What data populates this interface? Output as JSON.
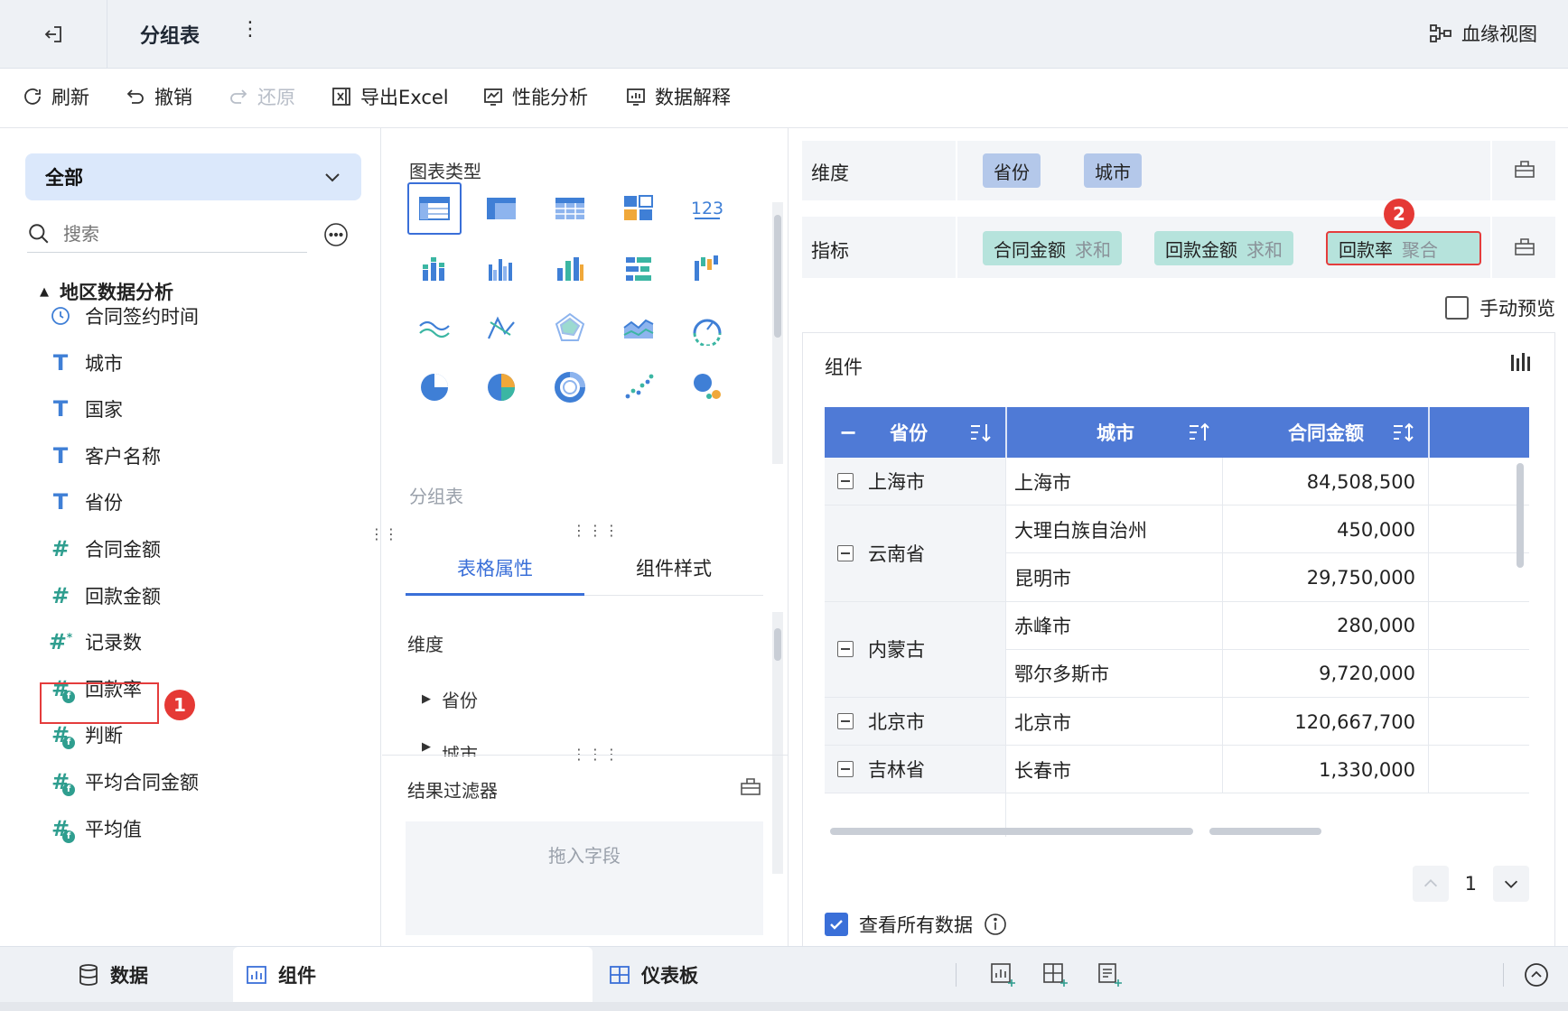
{
  "topbar": {
    "title": "分组表",
    "more": "⋮",
    "lineage_label": "血缘视图"
  },
  "toolbar": {
    "refresh": "刷新",
    "undo": "撤销",
    "redo": "还原",
    "export_excel": "导出Excel",
    "perf": "性能分析",
    "explain": "数据解释"
  },
  "left": {
    "scope": "全部",
    "search_placeholder": "搜索",
    "group": "地区数据分析",
    "fields": [
      {
        "label": "合同签约时间",
        "icon": "clock-icon"
      },
      {
        "label": "城市",
        "icon": "text-field-icon"
      },
      {
        "label": "国家",
        "icon": "text-field-icon"
      },
      {
        "label": "客户名称",
        "icon": "text-field-icon"
      },
      {
        "label": "省份",
        "icon": "text-field-icon"
      },
      {
        "label": "合同金额",
        "icon": "number-field-icon"
      },
      {
        "label": "回款金额",
        "icon": "number-field-icon"
      },
      {
        "label": "记录数",
        "icon": "count-field-icon"
      },
      {
        "label": "回款率",
        "icon": "calc-field-icon"
      },
      {
        "label": "判断",
        "icon": "calc-field-icon"
      },
      {
        "label": "平均合同金额",
        "icon": "calc-field-icon"
      },
      {
        "label": "平均值",
        "icon": "calc-field-icon"
      }
    ],
    "badge1": "1"
  },
  "middle": {
    "chart_type_label": "图表类型",
    "number_icon_text": "123",
    "selected_chart_name": "分组表",
    "tabs": [
      "表格属性",
      "组件样式"
    ],
    "dim_label": "维度",
    "dim_items": [
      "省份",
      "城市"
    ],
    "filter_label": "结果过滤器",
    "drop_hint": "拖入字段"
  },
  "right": {
    "dim_shelf": {
      "name": "维度",
      "pills": [
        "省份",
        "城市"
      ]
    },
    "met_shelf": {
      "name": "指标",
      "pills": [
        {
          "field": "合同金额",
          "agg": "求和"
        },
        {
          "field": "回款金额",
          "agg": "求和"
        },
        {
          "field": "回款率",
          "agg": "聚合"
        }
      ]
    },
    "badge2": "2",
    "manual_preview": "手动预览",
    "component_title": "组件",
    "table": {
      "headers": [
        "省份",
        "城市",
        "合同金额"
      ],
      "groups": [
        {
          "province": "上海市",
          "rows": [
            {
              "city": "上海市",
              "amount": "84,508,500"
            }
          ]
        },
        {
          "province": "云南省",
          "rows": [
            {
              "city": "大理白族自治州",
              "amount": "450,000"
            },
            {
              "city": "昆明市",
              "amount": "29,750,000"
            }
          ]
        },
        {
          "province": "内蒙古",
          "rows": [
            {
              "city": "赤峰市",
              "amount": "280,000"
            },
            {
              "city": "鄂尔多斯市",
              "amount": "9,720,000"
            }
          ]
        },
        {
          "province": "北京市",
          "rows": [
            {
              "city": "北京市",
              "amount": "120,667,700"
            }
          ]
        },
        {
          "province": "吉林省",
          "rows": [
            {
              "city": "长春市",
              "amount": "1,330,000"
            }
          ]
        }
      ]
    },
    "page_num": "1",
    "view_all": "查看所有数据"
  },
  "bottom": {
    "tabs": [
      "数据",
      "组件",
      "仪表板"
    ]
  },
  "colors": {
    "accent": "#3a6fd8",
    "header_blue": "#4f7ad6",
    "dim_pill": "#b4c8ea",
    "metric_pill": "#b6e3dc",
    "badge_red": "#e53935"
  }
}
